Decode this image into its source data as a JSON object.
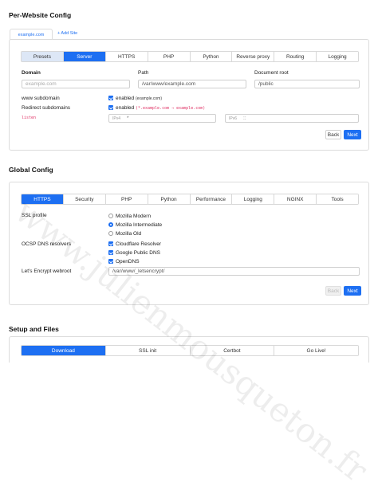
{
  "sections": {
    "per_website": "Per-Website Config",
    "global": "Global Config",
    "setup": "Setup and Files"
  },
  "site_tabs": {
    "active": "example.com",
    "add": "+ Add Site"
  },
  "site_config_tabs": [
    "Presets",
    "Server",
    "HTTPS",
    "PHP",
    "Python",
    "Reverse proxy",
    "Routing",
    "Logging"
  ],
  "server_form": {
    "domain": {
      "label": "Domain",
      "placeholder": "example.com"
    },
    "path": {
      "label": "Path",
      "value": "/var/www/example.com"
    },
    "root": {
      "label": "Document root",
      "value": "/public"
    },
    "www_subdomain": {
      "label": "www subdomain",
      "check_text": "enabled",
      "hint": "(example.com)"
    },
    "redirect": {
      "label": "Redirect subdomains",
      "check_text": "enabled",
      "code": "(*.example.com → example.com)"
    },
    "listen": {
      "label": "listen",
      "ipv4_prefix": "IPv4",
      "ipv4_value": "*",
      "ipv6_prefix": "IPv6",
      "ipv6_value": "::"
    },
    "back": "Back",
    "next": "Next"
  },
  "global_tabs": [
    "HTTPS",
    "Security",
    "PHP",
    "Python",
    "Performance",
    "Logging",
    "NGINX",
    "Tools"
  ],
  "global_form": {
    "ssl_profile": {
      "label": "SSL profile",
      "options": [
        "Mozilla Modern",
        "Mozilla Intermediate",
        "Mozilla Old"
      ],
      "selected": "Mozilla Intermediate"
    },
    "ocsp": {
      "label": "OCSP DNS resolvers",
      "options": [
        "Cloudflare Resolver",
        "Google Public DNS",
        "OpenDNS"
      ]
    },
    "letsencrypt": {
      "label": "Let's Encrypt webroot",
      "value": "/var/www/_letsencrypt/"
    },
    "back": "Back",
    "next": "Next"
  },
  "setup_tabs": [
    "Download",
    "SSL init",
    "Certbot",
    "Go Live!"
  ],
  "watermark": "www.julienmousqueton.fr",
  "colors": {
    "accent": "#1d6ff2",
    "code": "#e03366"
  }
}
